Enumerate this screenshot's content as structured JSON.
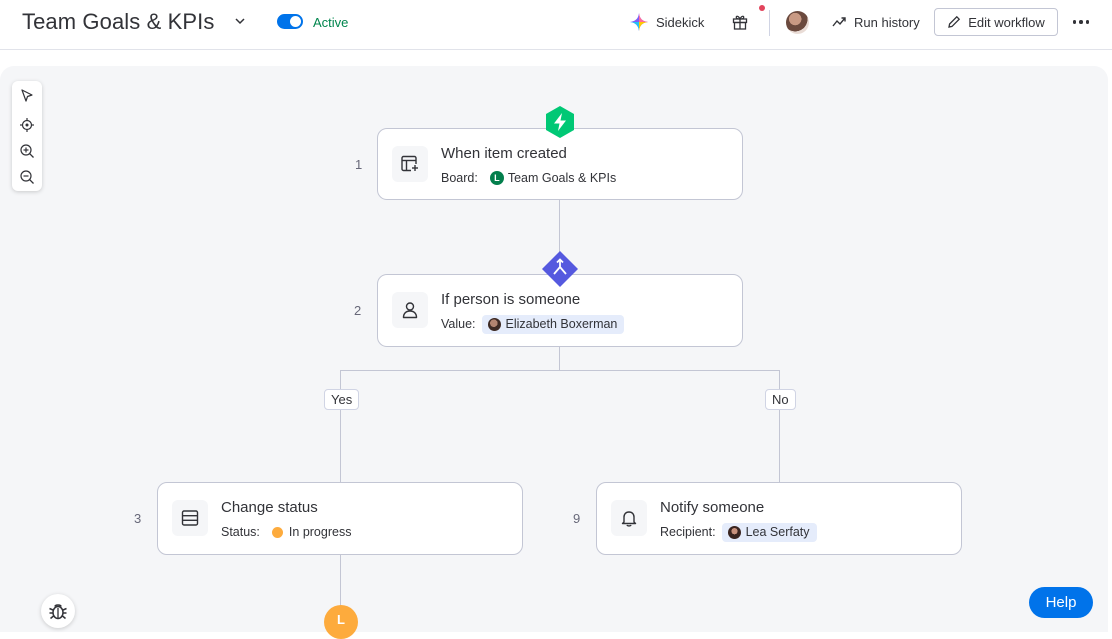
{
  "header": {
    "title": "Team Goals & KPIs",
    "status_label": "Active",
    "sidekick_label": "Sidekick",
    "run_history_label": "Run history",
    "edit_workflow_label": "Edit workflow"
  },
  "canvas": {
    "toolbar": [
      "pointer-tool",
      "focus-tool",
      "zoom-in",
      "zoom-out"
    ],
    "steps": [
      {
        "number": "1",
        "title": "When item created",
        "detail_label": "Board:",
        "detail_value": "Team Goals & KPIs",
        "detail_avatar_letter": "L"
      },
      {
        "number": "2",
        "title": "If person is someone",
        "detail_label": "Value:",
        "detail_value": "Elizabeth Boxerman"
      },
      {
        "number": "3",
        "title": "Change status",
        "detail_label": "Status:",
        "detail_value": "In progress",
        "status_color": "#fdab3d"
      },
      {
        "number": "9",
        "title": "Notify someone",
        "detail_label": "Recipient:",
        "detail_value": "Lea Serfaty"
      }
    ],
    "branches": {
      "yes": "Yes",
      "no": "No"
    },
    "next_node_letter": "L"
  },
  "help_label": "Help",
  "colors": {
    "accent": "#0073ea",
    "active_green": "#00854d",
    "trigger_green": "#00c875",
    "condition_purple": "#5559df",
    "in_progress_orange": "#fdab3d",
    "board_avatar_green": "#037f4c"
  }
}
